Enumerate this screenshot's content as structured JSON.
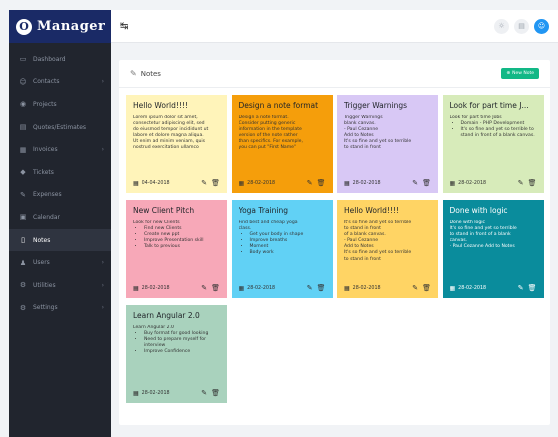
{
  "brand": {
    "logo_letter": "O",
    "name": "Manager"
  },
  "sidebar": {
    "items": [
      {
        "icon": "▭",
        "label": "Dashboard",
        "chevron": "",
        "active": false
      },
      {
        "icon": "☺",
        "label": "Contacts",
        "chevron": "›",
        "active": false
      },
      {
        "icon": "◉",
        "label": "Projects",
        "chevron": "",
        "active": false
      },
      {
        "icon": "▤",
        "label": "Quotes/Estimates",
        "chevron": "",
        "active": false
      },
      {
        "icon": "▦",
        "label": "Invoices",
        "chevron": "›",
        "active": false
      },
      {
        "icon": "◆",
        "label": "Tickets",
        "chevron": "",
        "active": false
      },
      {
        "icon": "✎",
        "label": "Expenses",
        "chevron": "",
        "active": false
      },
      {
        "icon": "▣",
        "label": "Calendar",
        "chevron": "",
        "active": false
      },
      {
        "icon": "▯",
        "label": "Notes",
        "chevron": "",
        "active": true
      },
      {
        "icon": "♟",
        "label": "Users",
        "chevron": "›",
        "active": false
      },
      {
        "icon": "⚙",
        "label": "Utilities",
        "chevron": "›",
        "active": false
      },
      {
        "icon": "⚙",
        "label": "Settings",
        "chevron": "›",
        "active": false
      }
    ]
  },
  "topbar": {
    "menu_icon": "↹",
    "icons": [
      "☼",
      "▤",
      "☺"
    ]
  },
  "panel": {
    "title_icon": "✎",
    "title": "Notes",
    "new_button": "New Note",
    "new_button_icon": "⊕"
  },
  "notes": [
    {
      "title": "Hello World!!!!",
      "color": "yellow",
      "body_lines": [
        "Lorem ipsum dolor sit amet,",
        "consectetur adipiscing elit, sed",
        "do eiusmod tempor incididunt ut",
        "labore et dolore magna aliqua.",
        "Ut enim ad minim veniam, quis",
        "nostrud exercitation ullamco"
      ],
      "bullets": [],
      "date": "04-04-2018"
    },
    {
      "title": "Design a note format",
      "color": "orange",
      "body_lines": [
        "Design a note format.",
        "Consider putting generic",
        "information in the template",
        "version of the note rather",
        "than specifics. For example,",
        "you can put \"First Name\""
      ],
      "bullets": [],
      "date": "28-02-2018"
    },
    {
      "title": "Trigger Warnings",
      "color": "purple",
      "body_lines": [
        "Trigger Warnings",
        "blank canvas.",
        "- Paul Cezanne",
        "Add to Notes",
        "It's so fine and yet so terrible",
        "to stand in front"
      ],
      "bullets": [],
      "date": "28-02-2018"
    },
    {
      "title": "Look for part time J...",
      "color": "green",
      "body_lines": [
        "Look for part time Jobs"
      ],
      "bullets": [
        "Domain - PHP Development",
        "It's so fine and yet so terrible to stand in front of a blank canvas."
      ],
      "date": "28-02-2018"
    },
    {
      "title": "New Client Pitch",
      "color": "pink",
      "body_lines": [
        "Look for new Clients"
      ],
      "bullets": [
        "Find new Clients",
        "Create new ppt",
        "Improve Presentation skill",
        "Talk to previous"
      ],
      "date": "28-02-2018"
    },
    {
      "title": "Yoga Training",
      "color": "blue",
      "body_lines": [
        "Find best and cheap yoga",
        "class."
      ],
      "bullets": [
        "Get your body in shape",
        "Improve breaths",
        "Moment",
        "Body work"
      ],
      "date": "28-02-2018"
    },
    {
      "title": "Hello World!!!!",
      "color": "gold",
      "body_lines": [
        "It's so fine and yet so terrible",
        "to stand in front",
        "of a blank canvas.",
        "- Paul Cezanne",
        "Add to Notes",
        "It's so fine and yet so terrible",
        "to stand in front"
      ],
      "bullets": [],
      "date": "28-02-2018"
    },
    {
      "title": "Done with logic",
      "color": "teal",
      "body_lines": [
        "Done with logic",
        "It's so fine and yet so terrible",
        "to stand in front of a blank",
        "canvas.",
        "- Paul Cezanne Add to Notes"
      ],
      "bullets": [],
      "date": "28-02-2018"
    },
    {
      "title": "Learn Angular 2.0",
      "color": "sage",
      "body_lines": [
        "Learn Angular 2.0"
      ],
      "bullets": [
        "Buy format for good looking",
        "Need to prepare myself for interview",
        "Improve Confidence"
      ],
      "date": "28-02-2018"
    }
  ],
  "icons": {
    "calendar": "▦",
    "edit": "✎",
    "delete": "🗑"
  }
}
